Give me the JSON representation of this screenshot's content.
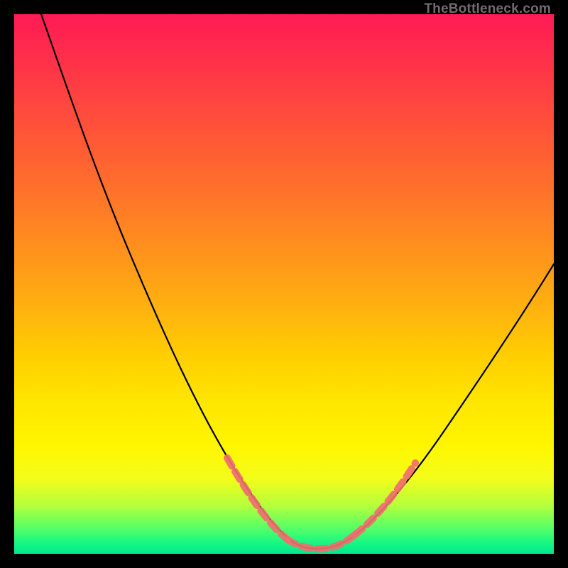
{
  "watermark": "TheBottleneck.com",
  "chart_data": {
    "type": "line",
    "title": "",
    "xlabel": "",
    "ylabel": "",
    "xlim": [
      0,
      100
    ],
    "ylim": [
      0,
      100
    ],
    "series": [
      {
        "name": "bottleneck-curve",
        "x": [
          5,
          10,
          15,
          20,
          25,
          30,
          35,
          40,
          45,
          50,
          52,
          54,
          56,
          58,
          60,
          62,
          65,
          70,
          75,
          80,
          85,
          90,
          95,
          100
        ],
        "y": [
          100,
          90,
          80,
          70,
          58,
          47,
          36,
          26,
          16,
          7,
          4,
          2,
          1,
          1,
          1,
          2,
          4,
          9,
          16,
          24,
          32,
          40,
          48,
          56
        ]
      }
    ],
    "highlight_segments": [
      {
        "side": "left",
        "x": [
          38,
          50
        ],
        "note": "pinkish dotted mask near valley left"
      },
      {
        "side": "right",
        "x": [
          62,
          73
        ],
        "note": "pinkish dotted mask near valley right"
      },
      {
        "side": "floor",
        "x": [
          50,
          62
        ],
        "note": "pinkish dotted mask along valley floor"
      }
    ],
    "colors": {
      "curve": "#000000",
      "highlight": "#ef6f6f",
      "background_top": "#ff1a55",
      "background_bottom": "#00e78e"
    }
  }
}
